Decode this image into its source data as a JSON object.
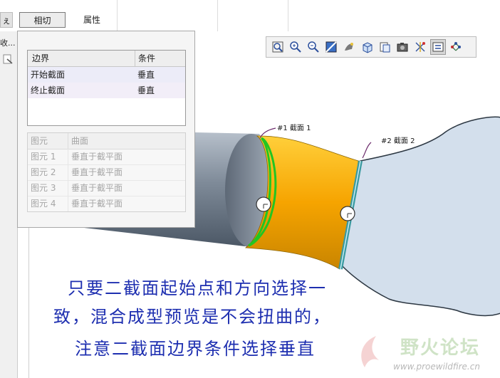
{
  "tabs": {
    "side_fragment": "ぇ",
    "tangency_label": "相切",
    "properties_label": "属性"
  },
  "left_pane": {
    "collapse_label": "收..."
  },
  "toolbar": {
    "buttons": [
      {
        "name": "zoom-fit-icon",
        "active": false
      },
      {
        "name": "zoom-in-icon",
        "active": false
      },
      {
        "name": "zoom-out-icon",
        "active": false
      },
      {
        "name": "repaint-icon",
        "active": false
      },
      {
        "name": "display-style-icon",
        "active": false
      },
      {
        "name": "saved-views-icon",
        "active": false
      },
      {
        "name": "view-manager-icon",
        "active": false
      },
      {
        "name": "snapshot-icon",
        "active": false
      },
      {
        "name": "datum-display-icon",
        "active": false
      },
      {
        "name": "orient-toggle-icon",
        "active": true
      },
      {
        "name": "spin-center-icon",
        "active": false
      }
    ]
  },
  "tangency_panel": {
    "boundary_table": {
      "headers": [
        "边界",
        "条件"
      ],
      "rows": [
        {
          "boundary": "开始截面",
          "condition": "垂直"
        },
        {
          "boundary": "终止截面",
          "condition": "垂直"
        }
      ]
    },
    "element_table": {
      "headers": [
        "图元",
        "曲面"
      ],
      "rows": [
        {
          "element": "图元 1",
          "surface": "垂直于截平面"
        },
        {
          "element": "图元 2",
          "surface": "垂直于截平面"
        },
        {
          "element": "图元 3",
          "surface": "垂直于截平面"
        },
        {
          "element": "图元 4",
          "surface": "垂直于截平面"
        }
      ]
    }
  },
  "model": {
    "section1_label": "#1 截面 1",
    "section2_label": "#2 截面 2"
  },
  "caption": {
    "line1": "只要二截面起始点和方向选择一",
    "line2": "致，混合成型预览是不会扭曲的，",
    "line3": "注意二截面边界条件选择垂直"
  },
  "watermark": {
    "text": "野火论坛",
    "url": "www.proewildfire.cn"
  },
  "colors": {
    "caption": "#1e2fb0",
    "blend_surface": "#f2a500",
    "section_outline": "#22c522",
    "pipe": "#7d8b9c",
    "sketch_plane": "#d3dfec"
  }
}
